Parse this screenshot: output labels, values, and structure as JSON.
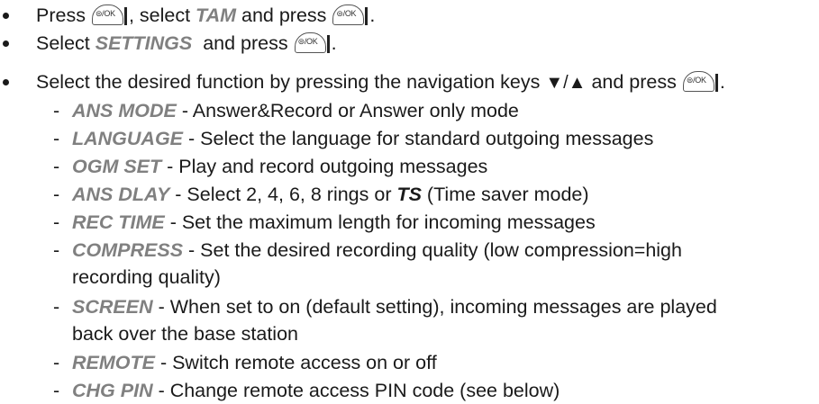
{
  "bullets": [
    {
      "parts": [
        "Press ",
        "[OK]",
        ", select ",
        "TAM",
        " and press ",
        "[OK]",
        "."
      ]
    },
    {
      "parts": [
        "Select ",
        "SETTINGS",
        "  and press ",
        "[OK]",
        "."
      ]
    },
    {
      "parts": [
        "Select the desired function by pressing the navigation keys ",
        "▼/▲",
        " and press ",
        "[OK]",
        "."
      ]
    }
  ],
  "ok_key_label": "⊜/OK",
  "ok_key_icon": "menu-ok-key-icon",
  "b1": {
    "t1": "Press ",
    "t2": ", select ",
    "kw": "TAM",
    "t3": " and press ",
    "t4": "."
  },
  "b2": {
    "t1": "Select ",
    "kw": "SETTINGS",
    "t2": "  and press ",
    "t3": "."
  },
  "b3": {
    "t1": "Select the desired function by pressing the navigation keys ",
    "arrows": "▼/▲",
    "t2": " and press ",
    "t3": "."
  },
  "functions": [
    {
      "name": "ANS MODE",
      "sep": " - ",
      "desc": "Answer&Record or Answer only mode"
    },
    {
      "name": "LANGUAGE",
      "sep": " - ",
      "desc": "Select the language for standard outgoing messages"
    },
    {
      "name": "OGM SET",
      "sep": " - ",
      "desc": "Play and record outgoing messages"
    },
    {
      "name": "ANS DLAY",
      "sep": " - ",
      "desc": "Select 2, 4, 6, 8 rings or ",
      "extra_kw": "TS",
      "desc2": " (Time saver mode)"
    },
    {
      "name": "REC TIME",
      "sep": " - ",
      "desc": "Set the maximum length for incoming messages"
    },
    {
      "name": "COMPRESS",
      "sep": " - ",
      "desc": "Set the desired recording quality (low compression=high",
      "cont": "recording quality)"
    },
    {
      "name": "SCREEN",
      "sep": " - ",
      "desc": "When set to on (default setting), incoming messages are played",
      "cont": "back over the base station"
    },
    {
      "name": "REMOTE",
      "sep": " - ",
      "desc": "Switch remote access on or off"
    },
    {
      "name": "CHG PIN",
      "sep": " - ",
      "desc": "Change remote access PIN code (see below)"
    }
  ],
  "dash": "-"
}
